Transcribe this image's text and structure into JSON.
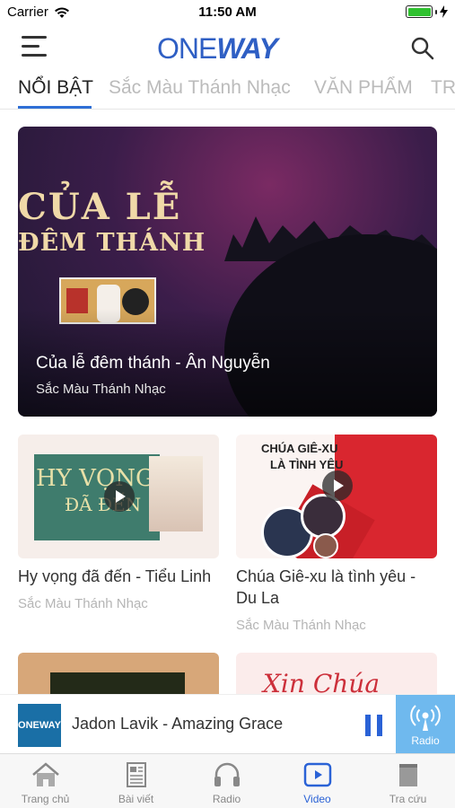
{
  "status_bar": {
    "carrier": "Carrier",
    "time": "11:50 AM",
    "battery_level": 1.0
  },
  "header": {
    "logo_one": "ONE",
    "logo_way": "WAY"
  },
  "tabs": [
    {
      "label": "NỔI BẬT",
      "active": true
    },
    {
      "label": "Sắc Màu Thánh Nhạc",
      "active": false
    },
    {
      "label": "VĂN PHẨM",
      "active": false
    },
    {
      "label": "TR",
      "active": false
    }
  ],
  "hero": {
    "image_text_line1": "CỦA LỄ",
    "image_text_line2": "ĐÊM THÁNH",
    "title": "Của lễ đêm thánh - Ân Nguyễn",
    "category": "Sắc Màu Thánh Nhạc"
  },
  "cards": [
    {
      "title": "Hy vọng đã đến - Tiểu Linh",
      "category": "Sắc Màu Thánh Nhạc",
      "image_text_line1": "HY VỌNG",
      "image_text_line2": "ĐÃ ĐẾN"
    },
    {
      "title": "Chúa Giê-xu là tình yêu - Du La",
      "category": "Sắc Màu Thánh Nhạc",
      "image_text_line1": "CHÚA GIÊ-XU",
      "image_text_line2": "LÀ TÌNH YÊU"
    },
    {
      "title": "",
      "category": ""
    },
    {
      "title": "",
      "category": "",
      "image_text_line1": "Xin Chúa"
    }
  ],
  "player": {
    "cover_label": "ONEWAY",
    "song": "Jadon Lavik - Amazing Grace",
    "radio_label": "Radio"
  },
  "tabbar": [
    {
      "label": "Trang chủ",
      "icon": "home-icon",
      "active": false
    },
    {
      "label": "Bài viết",
      "icon": "article-icon",
      "active": false
    },
    {
      "label": "Radio",
      "icon": "headphones-icon",
      "active": false
    },
    {
      "label": "Video",
      "icon": "video-icon",
      "active": true
    },
    {
      "label": "Tra cứu",
      "icon": "book-icon",
      "active": false
    }
  ],
  "colors": {
    "accent": "#2a62d6",
    "logo": "#2f5fc4",
    "radio": "#6fb9ee",
    "battery": "#2fc12f"
  }
}
